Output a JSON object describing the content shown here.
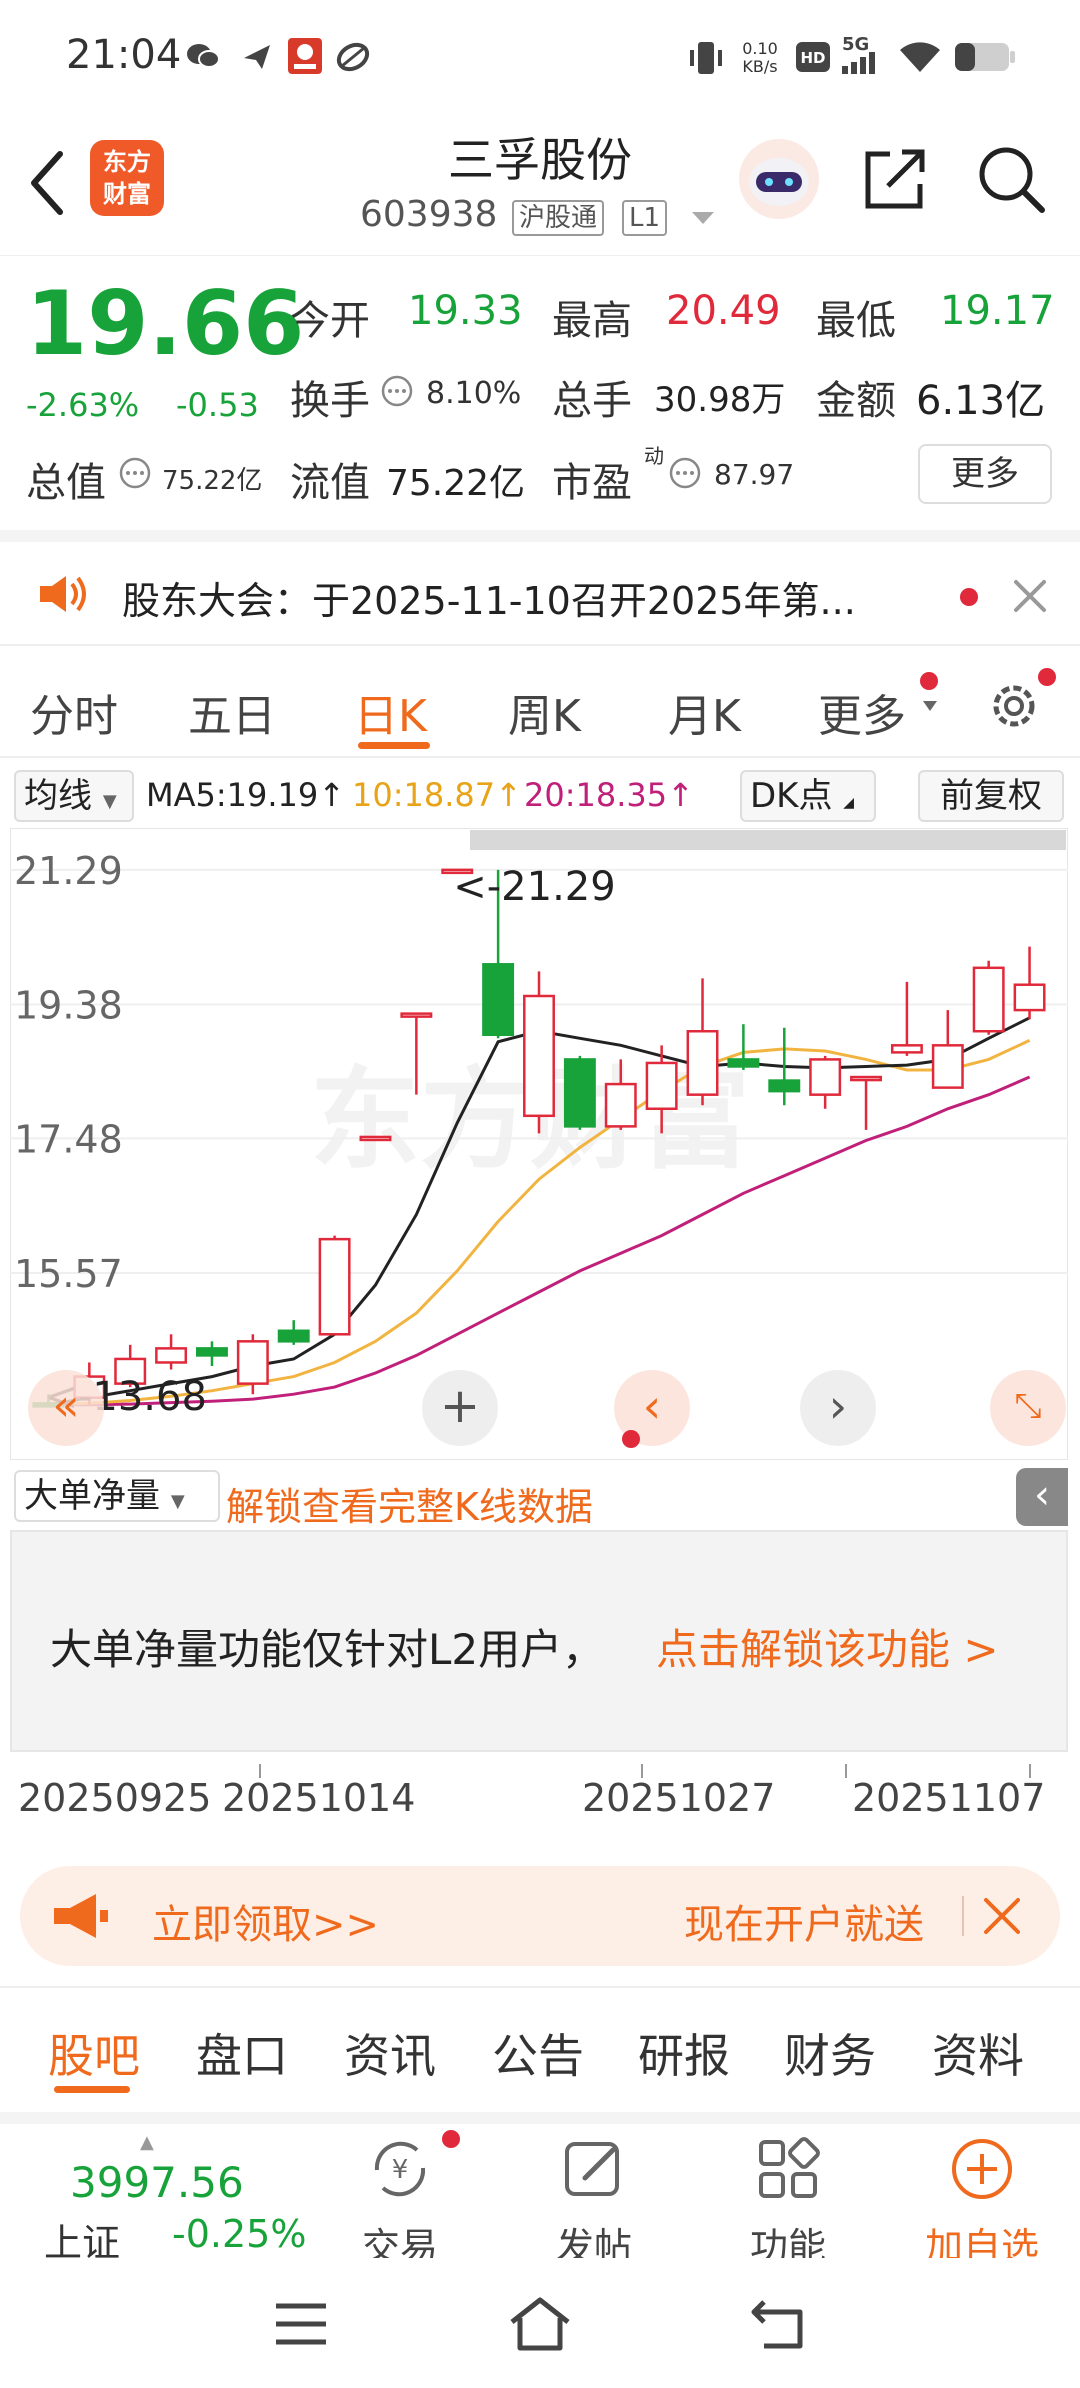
{
  "status_bar": {
    "time": "21:04",
    "net_speed_value": "0.10",
    "net_speed_unit": "KB/s",
    "network": "5G",
    "signal_bars": 4,
    "battery_level": 0.35
  },
  "header": {
    "stock_name": "三孚股份",
    "stock_code": "603938",
    "tag_connect": "沪股通",
    "tag_level": "L1",
    "logo_line1": "东方",
    "logo_line2": "财富"
  },
  "quote": {
    "price": "19.66",
    "change_pct": "-2.63%",
    "change_amt": "-0.53",
    "open_label": "今开",
    "open": "19.33",
    "high_label": "最高",
    "high": "20.49",
    "low_label": "最低",
    "low": "19.17",
    "turnover_label": "换手",
    "turnover": "8.10%",
    "volume_label": "总手",
    "volume": "30.98万",
    "amount_label": "金额",
    "amount": "6.13亿",
    "mktcap_label": "总值",
    "mktcap": "75.22亿",
    "float_label": "流值",
    "float_cap": "75.22亿",
    "pe_label": "市盈",
    "pe_sup": "动",
    "pe": "87.97",
    "more_label": "更多"
  },
  "notice": {
    "text": "股东大会：于2025-11-10召开2025年第..."
  },
  "ktabs": {
    "items": [
      "分时",
      "五日",
      "日K",
      "周K",
      "月K",
      "更多"
    ],
    "active": 2
  },
  "ma_row": {
    "selector": "均线",
    "ma5": "MA5:19.19↑",
    "ma10": "10:18.87↑",
    "ma20": "20:18.35↑",
    "dk_label": "DK点",
    "adjust_label": "前复权"
  },
  "colors": {
    "up": "#e0293a",
    "down": "#18a33a",
    "accent": "#f06a1d",
    "ma5": "#222222",
    "ma10": "#f2b440",
    "ma20": "#c0207a"
  },
  "chart_data": {
    "type": "candlestick",
    "y_ticks": [
      "21.29",
      "19.38",
      "17.48",
      "15.57"
    ],
    "ylim": [
      13.2,
      21.6
    ],
    "max_label": "<-21.29",
    "min_label": "<-13.68",
    "x_labels": [
      "20250925",
      "20251014",
      "20251027",
      "20251107"
    ],
    "watermark": "东方财富",
    "candles": [
      {
        "o": 13.72,
        "c": 13.7,
        "h": 13.85,
        "l": 13.68
      },
      {
        "o": 13.8,
        "c": 14.1,
        "h": 14.3,
        "l": 13.7
      },
      {
        "o": 14.0,
        "c": 14.35,
        "h": 14.55,
        "l": 13.95
      },
      {
        "o": 14.3,
        "c": 14.5,
        "h": 14.7,
        "l": 14.2
      },
      {
        "o": 14.5,
        "c": 14.4,
        "h": 14.6,
        "l": 14.25
      },
      {
        "o": 14.0,
        "c": 14.6,
        "h": 14.7,
        "l": 13.85
      },
      {
        "o": 14.75,
        "c": 14.6,
        "h": 14.9,
        "l": 14.55
      },
      {
        "o": 14.7,
        "c": 16.05,
        "h": 16.1,
        "l": 14.7
      },
      {
        "o": 17.5,
        "c": 17.5,
        "h": 17.5,
        "l": 17.5
      },
      {
        "o": 19.25,
        "c": 19.25,
        "h": 19.25,
        "l": 18.1
      },
      {
        "o": 21.29,
        "c": 21.29,
        "h": 21.29,
        "l": 21.29
      },
      {
        "o": 19.95,
        "c": 18.95,
        "h": 21.29,
        "l": 18.9
      },
      {
        "o": 17.8,
        "c": 19.5,
        "h": 19.85,
        "l": 17.55
      },
      {
        "o": 18.6,
        "c": 17.65,
        "h": 18.65,
        "l": 17.6
      },
      {
        "o": 17.65,
        "c": 18.25,
        "h": 18.6,
        "l": 17.6
      },
      {
        "o": 17.9,
        "c": 18.55,
        "h": 18.8,
        "l": 17.55
      },
      {
        "o": 18.1,
        "c": 19.0,
        "h": 19.75,
        "l": 17.95
      },
      {
        "o": 18.6,
        "c": 18.5,
        "h": 19.1,
        "l": 18.45
      },
      {
        "o": 18.3,
        "c": 18.15,
        "h": 19.05,
        "l": 17.95
      },
      {
        "o": 18.1,
        "c": 18.6,
        "h": 18.65,
        "l": 17.9
      },
      {
        "o": 18.35,
        "c": 18.35,
        "h": 18.35,
        "l": 17.6
      },
      {
        "o": 18.7,
        "c": 18.8,
        "h": 19.7,
        "l": 18.65
      },
      {
        "o": 18.2,
        "c": 18.8,
        "h": 19.3,
        "l": 18.2
      },
      {
        "o": 19.0,
        "c": 19.9,
        "h": 20.0,
        "l": 18.95
      },
      {
        "o": 19.3,
        "c": 19.66,
        "h": 20.2,
        "l": 19.17
      }
    ],
    "ma5": [
      13.7,
      13.8,
      13.9,
      14.0,
      14.1,
      14.25,
      14.35,
      14.7,
      15.4,
      16.4,
      17.7,
      18.85,
      19.0,
      18.9,
      18.8,
      18.65,
      18.5,
      18.55,
      18.5,
      18.48,
      18.5,
      18.52,
      18.6,
      18.9,
      19.19
    ],
    "ma10": [
      13.7,
      13.72,
      13.76,
      13.82,
      13.9,
      14.0,
      14.1,
      14.3,
      14.6,
      15.0,
      15.6,
      16.3,
      16.9,
      17.35,
      17.75,
      18.15,
      18.5,
      18.7,
      18.75,
      18.72,
      18.6,
      18.45,
      18.45,
      18.6,
      18.87
    ],
    "ma20": [
      13.7,
      13.7,
      13.71,
      13.73,
      13.75,
      13.78,
      13.85,
      13.95,
      14.15,
      14.4,
      14.7,
      15.0,
      15.3,
      15.6,
      15.85,
      16.1,
      16.4,
      16.7,
      16.95,
      17.2,
      17.45,
      17.65,
      17.9,
      18.1,
      18.35
    ]
  },
  "l2": {
    "selector": "大单净量",
    "unlock_text": "解锁查看完整K线数据",
    "panel_text": "大单净量功能仅针对L2用户，",
    "panel_link": "点击解锁该功能 >"
  },
  "promo": {
    "left": "立即领取>>",
    "right": "现在开户就送"
  },
  "bottom_tabs": {
    "items": [
      "股吧",
      "盘口",
      "资讯",
      "公告",
      "研报",
      "财务",
      "资料"
    ],
    "active": 0
  },
  "toolbar": {
    "index_value": "3997.56",
    "index_name": "上证",
    "index_change": "-0.25%",
    "trade": "交易",
    "post": "发帖",
    "func": "功能",
    "watch": "加自选"
  }
}
